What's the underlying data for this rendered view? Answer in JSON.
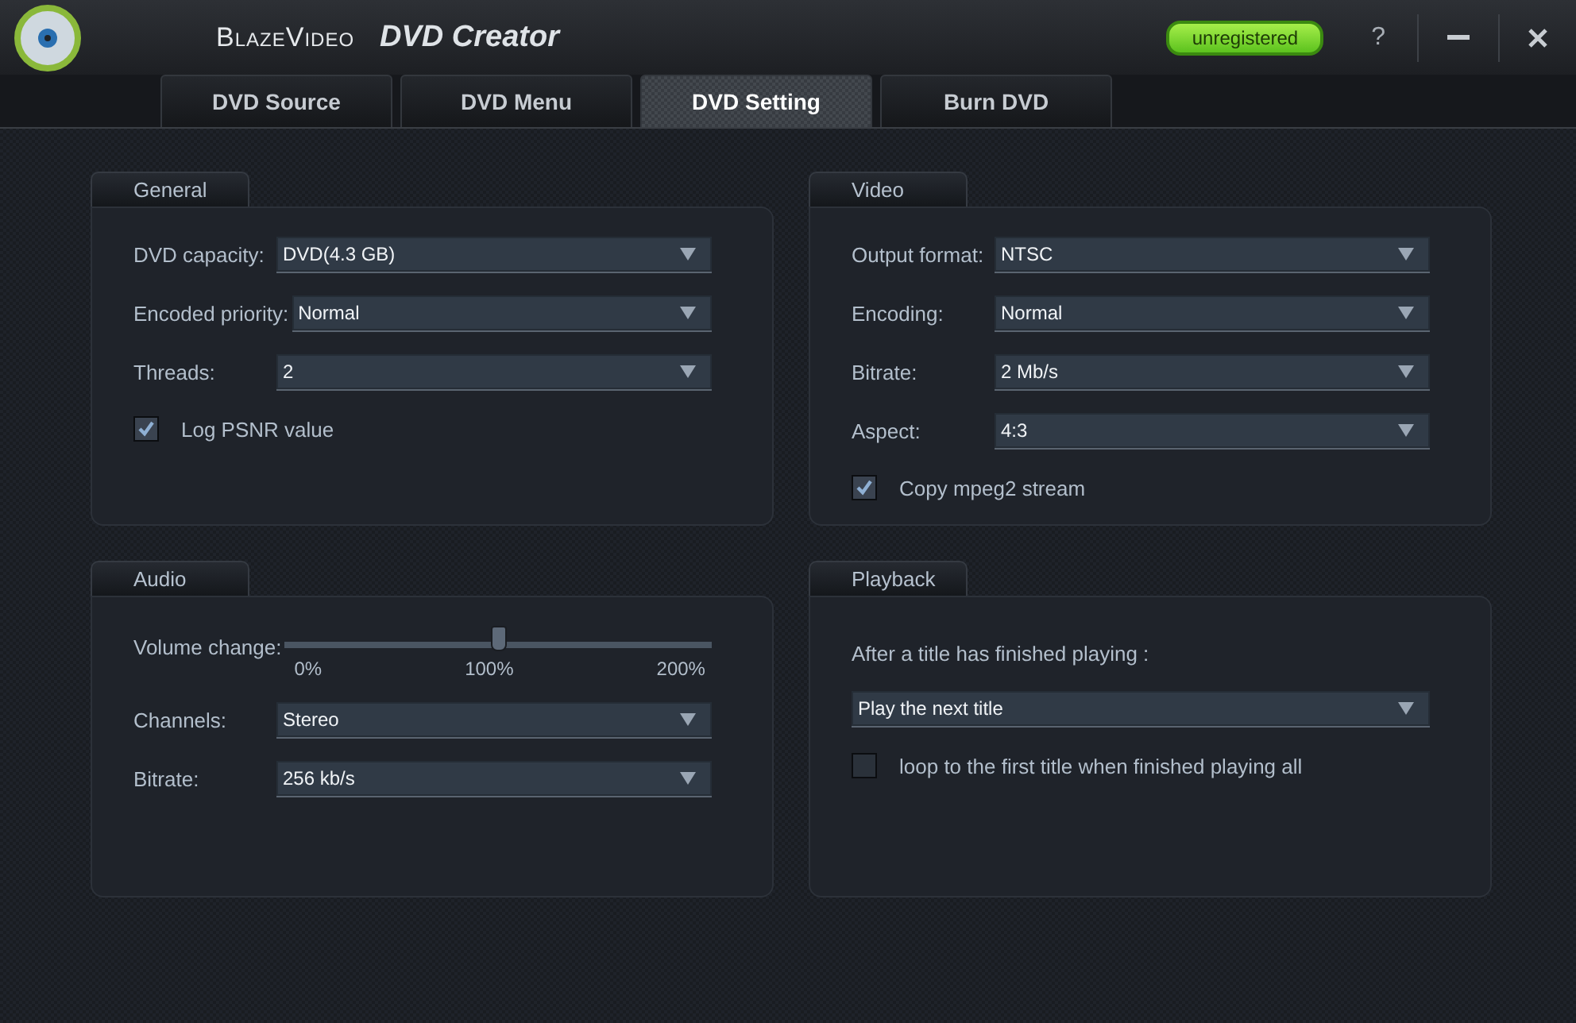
{
  "window": {
    "brand": "BlazeVideo",
    "title": "DVD Creator",
    "badge": "unregistered",
    "buttons": [
      {
        "kind": "help",
        "label": "?"
      },
      {
        "kind": "minimize"
      },
      {
        "kind": "close"
      }
    ]
  },
  "tabs": [
    {
      "label": "DVD Source",
      "selected": false
    },
    {
      "label": "DVD Menu",
      "selected": false
    },
    {
      "label": "DVD Setting",
      "selected": true
    },
    {
      "label": "Burn DVD",
      "selected": false
    }
  ],
  "panels": [
    {
      "title": "General",
      "rows": [
        {
          "kind": "select",
          "label": "DVD capacity:",
          "value": "DVD(4.3 GB)"
        },
        {
          "kind": "select",
          "label": "Encoded priority:",
          "value": "Normal"
        },
        {
          "kind": "select",
          "label": "Threads:",
          "value": "2"
        },
        {
          "kind": "checkbox",
          "label": "Log PSNR value",
          "checked": true
        }
      ]
    },
    {
      "title": "Video",
      "rows": [
        {
          "kind": "select",
          "label": "Output format:",
          "value": "NTSC"
        },
        {
          "kind": "select",
          "label": "Encoding:",
          "value": "Normal"
        },
        {
          "kind": "select",
          "label": "Bitrate:",
          "value": "2 Mb/s"
        },
        {
          "kind": "select",
          "label": "Aspect:",
          "value": "4:3"
        },
        {
          "kind": "checkbox",
          "label": "Copy mpeg2 stream",
          "checked": true
        }
      ]
    },
    {
      "title": "Audio",
      "rows": [
        {
          "kind": "slider",
          "label": "Volume change:",
          "level": 0.5,
          "ticks": [
            "0%",
            "100%",
            "200%"
          ]
        },
        {
          "kind": "select",
          "label": "Channels:",
          "value": "Stereo"
        },
        {
          "kind": "select",
          "label": "Bitrate:",
          "value": "256 kb/s"
        }
      ]
    },
    {
      "title": "Playback",
      "rows": [
        {
          "kind": "text",
          "label": "After a title has finished playing :"
        },
        {
          "kind": "select",
          "value": "Play the next title"
        },
        {
          "kind": "checkbox",
          "label": "loop to the first title when finished playing all",
          "checked": false
        }
      ]
    }
  ]
}
